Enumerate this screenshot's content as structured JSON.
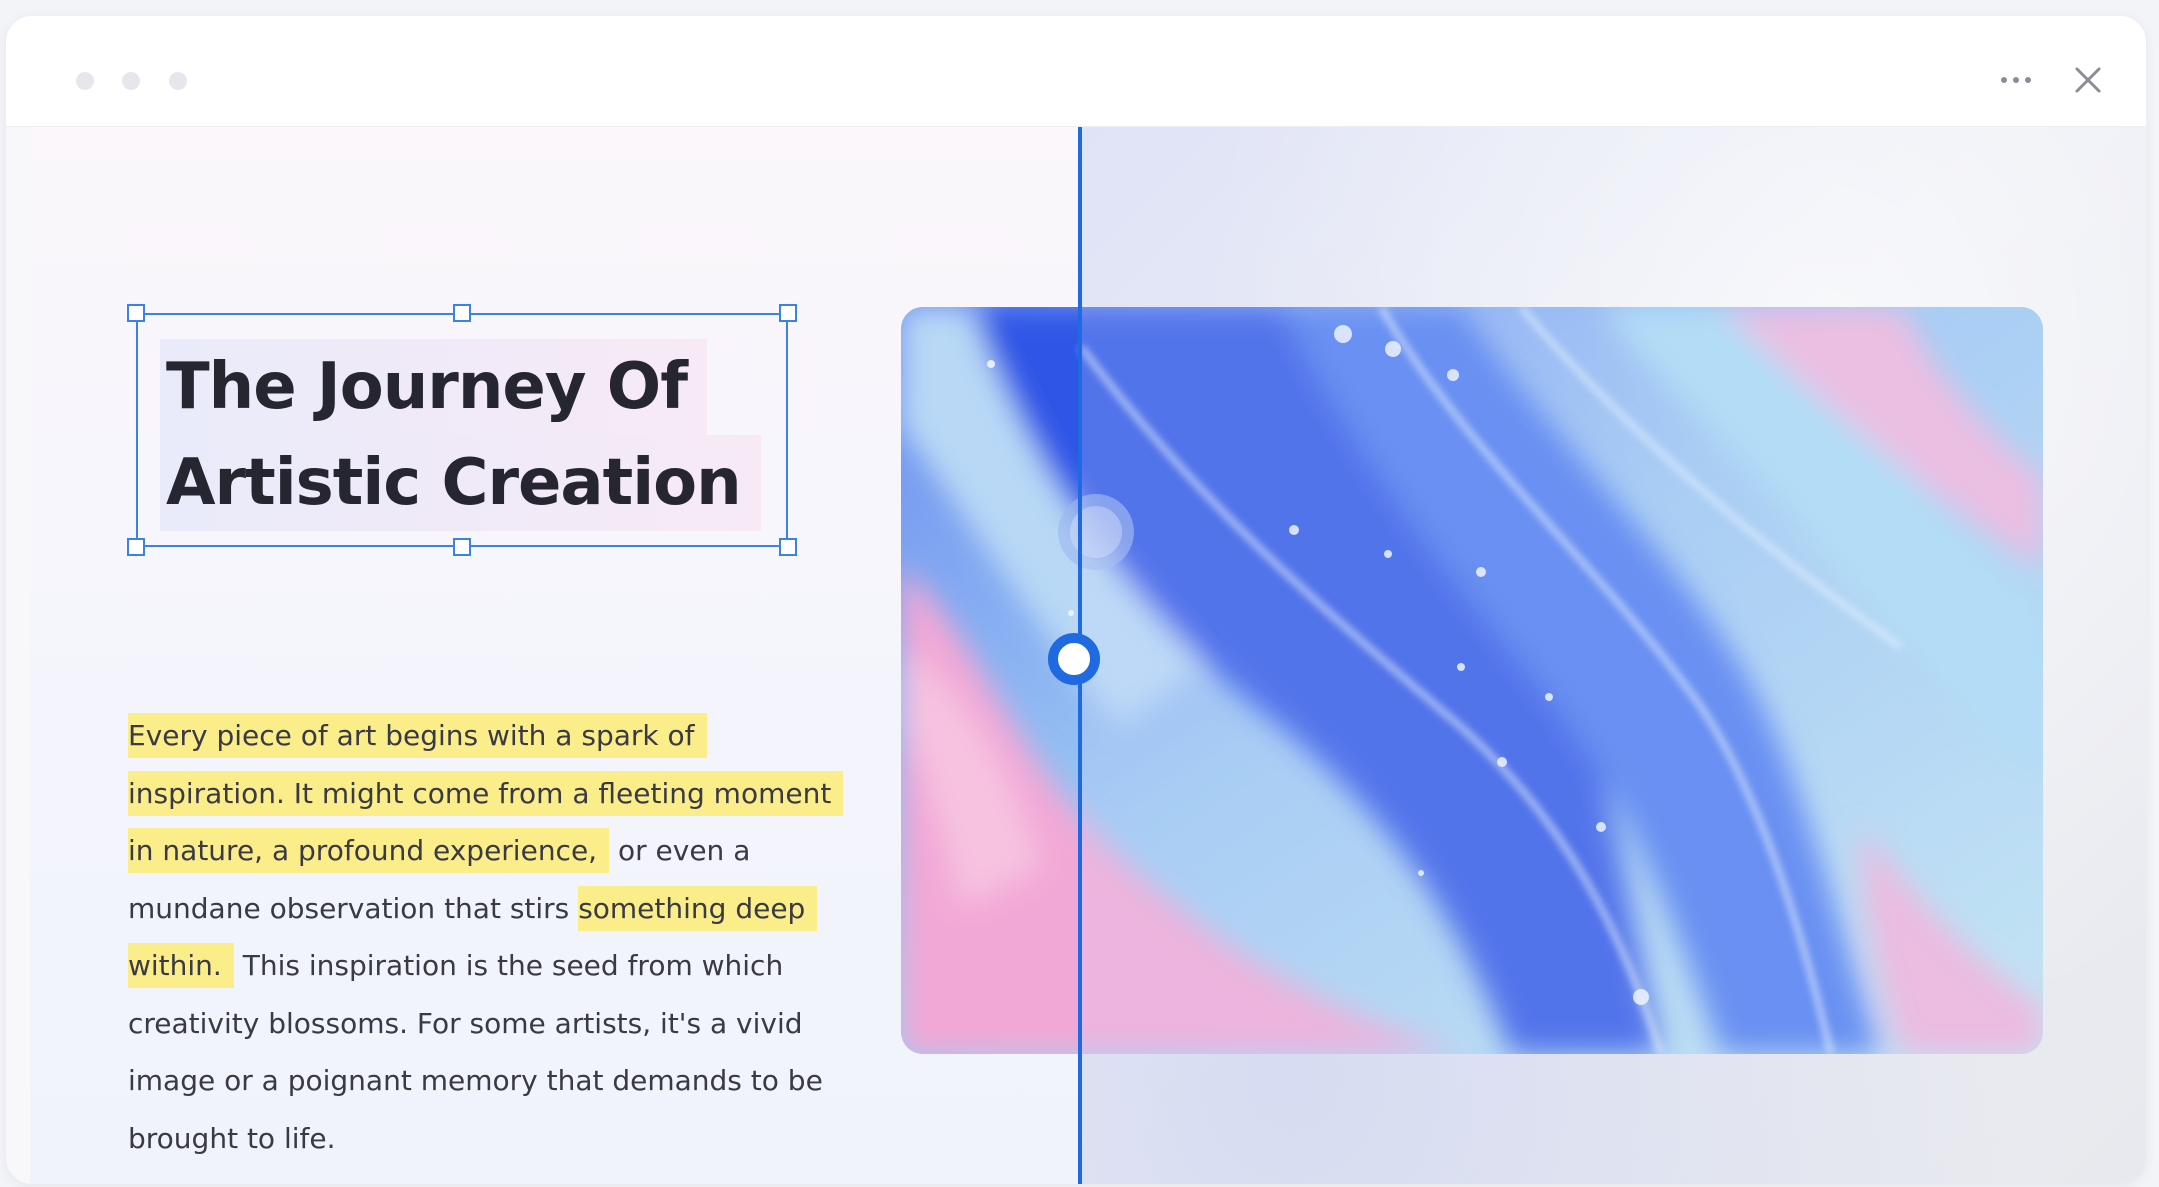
{
  "window": {
    "controls": [
      "more-icon",
      "close-icon"
    ]
  },
  "slide": {
    "title_line1": "The Journey Of",
    "title_line2": "Artistic Creation",
    "body_highlighted": "Every piece of art begins with a spark of inspiration. It might come from a fleeting moment in nature, a profound experience,",
    "body_plain": " or even a mundane observation that stirs ",
    "body_highlighted_2": "something deep within.",
    "body_tail": " This inspiration is the seed from which creativity blossoms. For some artists, it's a vivid image or a poignant memory that demands to be brought to life."
  },
  "image": {
    "description": "marbled fluid art in blue, pink and white"
  },
  "colors": {
    "accent": "#1f6ae0",
    "highlight": "#fbee8a",
    "text": "#262630"
  }
}
